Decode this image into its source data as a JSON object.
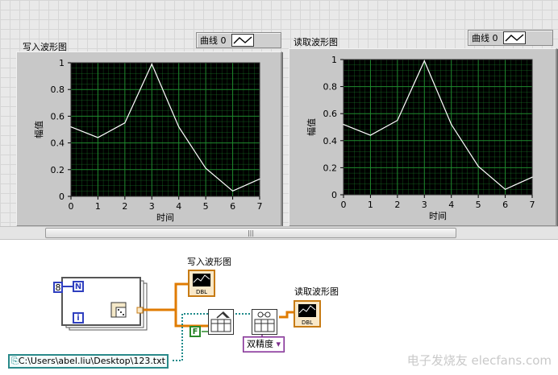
{
  "front_panel": {
    "graphs": [
      {
        "label": "写入波形图",
        "legend": "曲线 0",
        "ylabel": "幅值",
        "xlabel": "时间",
        "y_ticks": [
          "0",
          "0.2",
          "0.4",
          "0.6",
          "0.8",
          "1"
        ],
        "x_ticks": [
          "0",
          "1",
          "2",
          "3",
          "4",
          "5",
          "6",
          "7"
        ],
        "background_color": "#000000",
        "grid_color": "#1f8a2e",
        "trace_color": "#ffffff"
      },
      {
        "label": "读取波形图",
        "legend": "曲线 0",
        "ylabel": "幅值",
        "xlabel": "时间",
        "y_ticks": [
          "0",
          "0.2",
          "0.4",
          "0.6",
          "0.8",
          "1"
        ],
        "x_ticks": [
          "0",
          "1",
          "2",
          "3",
          "4",
          "5",
          "6",
          "7"
        ],
        "background_color": "#000000",
        "grid_color": "#1f8a2e",
        "trace_color": "#ffffff"
      }
    ],
    "scrollbar_grip": "|||"
  },
  "chart_data": [
    {
      "type": "line",
      "xlabel": "时间",
      "ylabel": "幅值",
      "xlim": [
        0,
        7
      ],
      "ylim": [
        0,
        1
      ],
      "grid": true,
      "legend_placement": "top-right",
      "series": [
        {
          "name": "曲线 0",
          "x": [
            0,
            1,
            2,
            3,
            4,
            5,
            6,
            7
          ],
          "values": [
            0.52,
            0.44,
            0.55,
            0.99,
            0.52,
            0.21,
            0.04,
            0.13
          ]
        }
      ]
    },
    {
      "type": "line",
      "xlabel": "时间",
      "ylabel": "幅值",
      "xlim": [
        0,
        7
      ],
      "ylim": [
        0,
        1
      ],
      "grid": true,
      "legend_placement": "top-right",
      "series": [
        {
          "name": "曲线 0",
          "x": [
            0,
            1,
            2,
            3,
            4,
            5,
            6,
            7
          ],
          "values": [
            0.52,
            0.44,
            0.55,
            0.99,
            0.52,
            0.21,
            0.04,
            0.13
          ]
        }
      ]
    }
  ],
  "block_diagram": {
    "count_constant": "8",
    "count_terminal": "N",
    "iteration_terminal": "i",
    "write_graph_label": "写入波形图",
    "read_graph_label": "读取波形图",
    "boolean_constant": "F",
    "path_constant": "C:\\Users\\abel.liu\\Desktop\\123.txt",
    "path_prefix_icon": "path-icon",
    "enum_value": "双精度",
    "enum_arrow": "▾",
    "indicator_type": "DBL",
    "wire_numeric_color": "#e07b00",
    "wire_path_color": "#1f8a8a",
    "wire_boolean_color": "#2a8a2a"
  },
  "watermark": "电子发烧友 elecfans.com"
}
